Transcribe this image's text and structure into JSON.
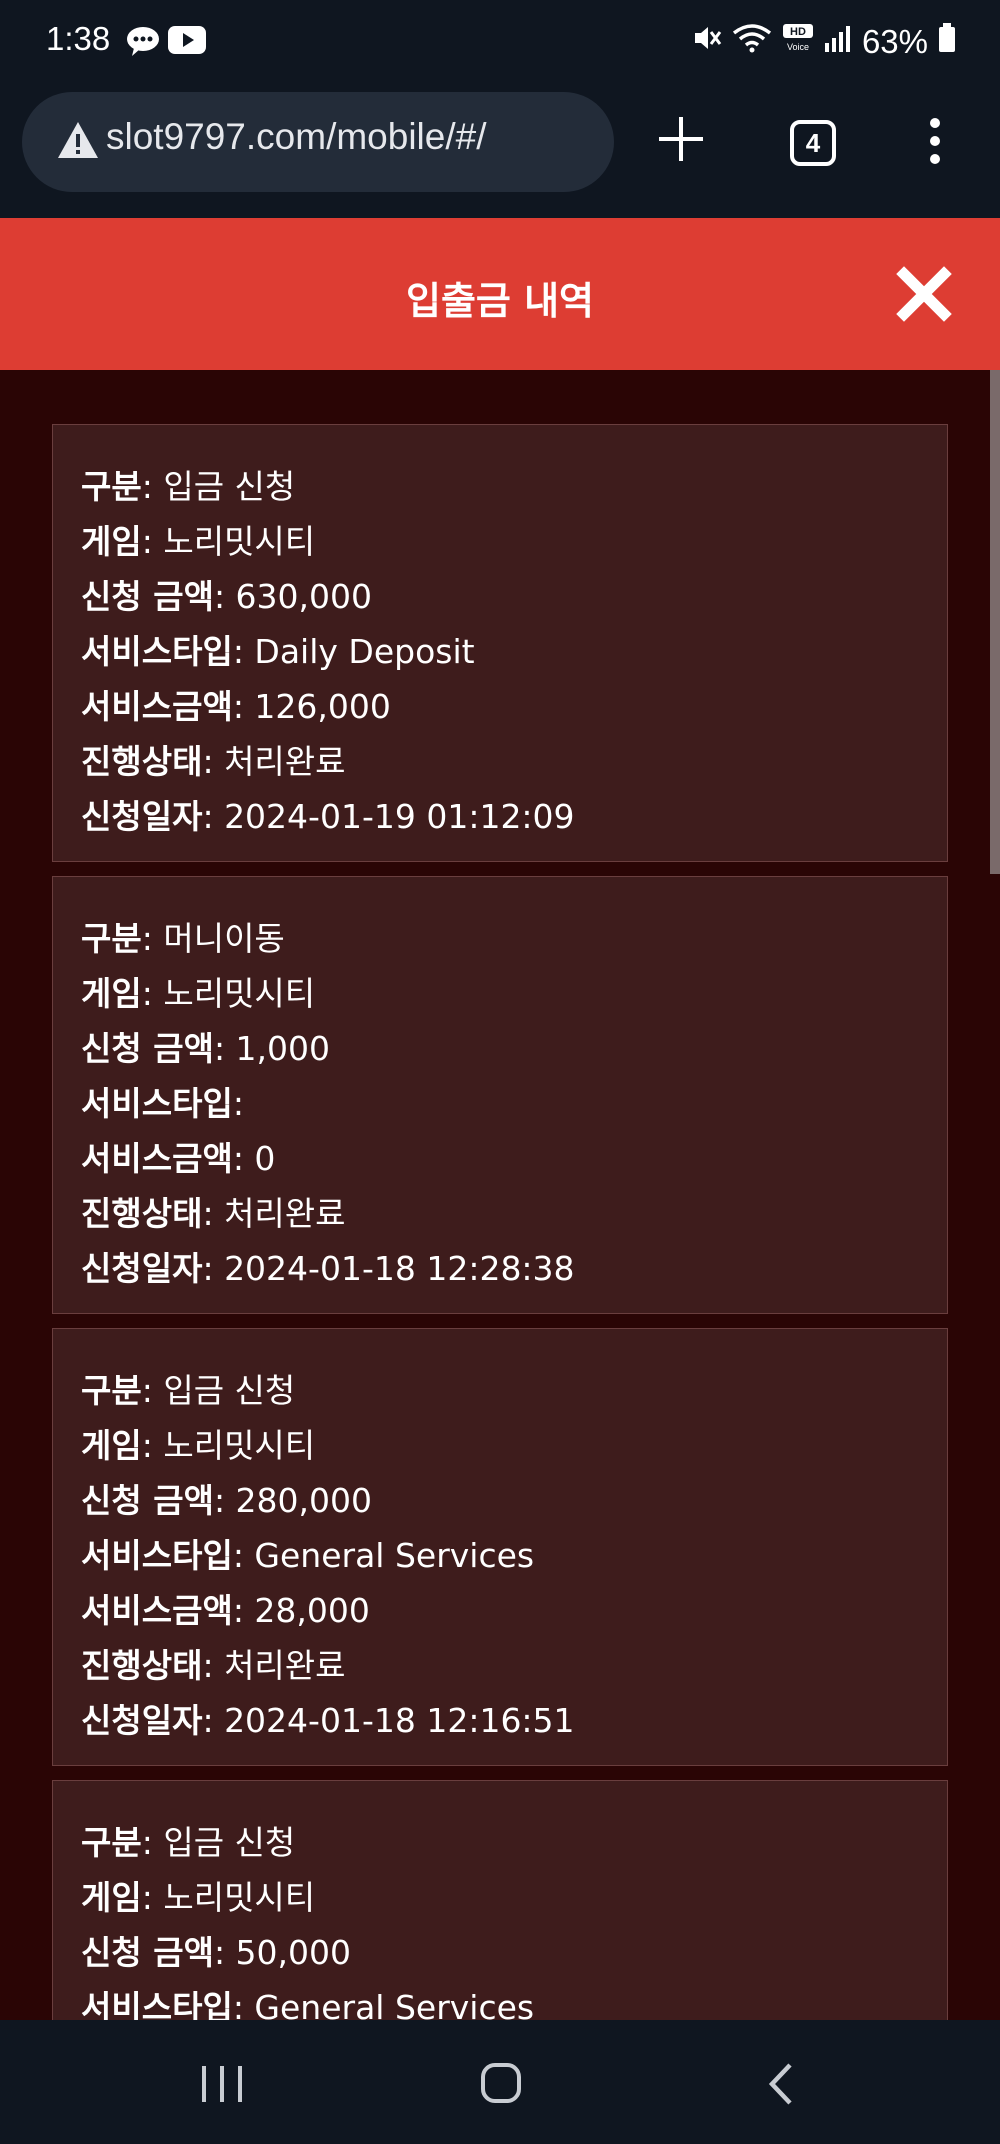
{
  "status_bar": {
    "time": "1:38",
    "battery": "63%"
  },
  "browser": {
    "url": "slot9797.com/mobile/#/",
    "tab_count": "4"
  },
  "modal": {
    "title": "입출금 내역"
  },
  "labels": {
    "type": "구분",
    "game": "게임",
    "amount": "신청 금액",
    "service_type": "서비스타입",
    "service_amount": "서비스금액",
    "status": "진행상태",
    "date": "신청일자"
  },
  "records": [
    {
      "type": "입금 신청",
      "game": "노리밋시티",
      "amount": "630,000",
      "service_type": "Daily Deposit",
      "service_amount": "126,000",
      "status": "처리완료",
      "date": "2024-01-19 01:12:09"
    },
    {
      "type": "머니이동",
      "game": "노리밋시티",
      "amount": "1,000",
      "service_type": "",
      "service_amount": "0",
      "status": "처리완료",
      "date": "2024-01-18 12:28:38"
    },
    {
      "type": "입금 신청",
      "game": "노리밋시티",
      "amount": "280,000",
      "service_type": "General Services",
      "service_amount": "28,000",
      "status": "처리완료",
      "date": "2024-01-18 12:16:51"
    },
    {
      "type": "입금 신청",
      "game": "노리밋시티",
      "amount": "50,000",
      "service_type": "General Services"
    }
  ],
  "colors": {
    "header_red": "#dd3d33",
    "content_bg": "#2a0505",
    "card_bg": "#3e1c1c",
    "system_bar": "#0f1620"
  },
  "icons": {
    "status_left": [
      "message-icon",
      "youtube-icon"
    ],
    "status_right": [
      "mute-icon",
      "wifi-icon",
      "hd-voice-icon",
      "signal-icon",
      "battery-icon"
    ],
    "browser": [
      "warning-icon",
      "plus-icon",
      "tabs-icon",
      "more-menu-icon"
    ],
    "modal": [
      "close-icon"
    ],
    "nav": [
      "recent-apps-icon",
      "home-icon",
      "back-icon"
    ]
  }
}
